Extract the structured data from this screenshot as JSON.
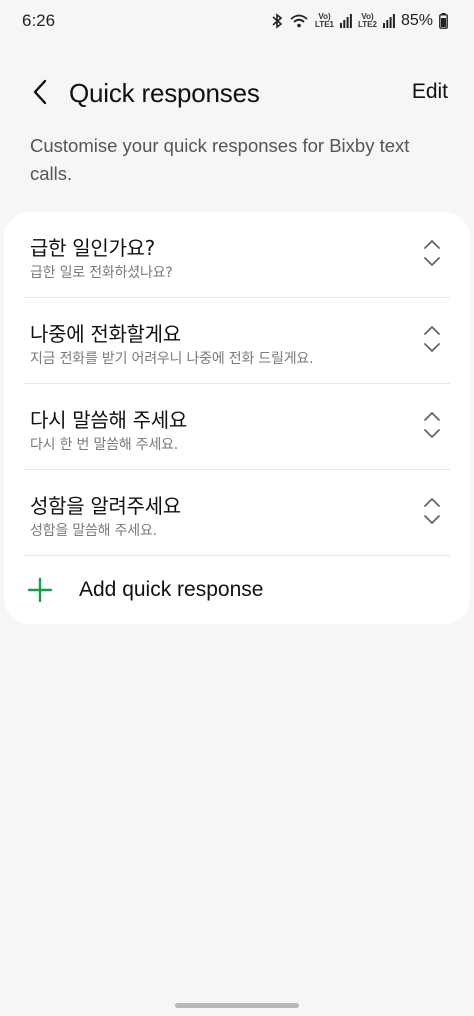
{
  "status_bar": {
    "time": "6:26",
    "battery": "85%",
    "sim1_label_top": "Vo)",
    "sim1_label_bottom": "LTE1",
    "sim2_label_top": "Vo)",
    "sim2_label_bottom": "LTE2",
    "icons": [
      "bluetooth-icon",
      "wifi-icon",
      "signal-icon",
      "battery-icon"
    ]
  },
  "header": {
    "title": "Quick responses",
    "edit_label": "Edit",
    "back_icon": "chevron-left-icon"
  },
  "description": "Customise your quick responses for Bixby text calls.",
  "responses": [
    {
      "title": "급한 일인가요?",
      "subtitle": "급한 일로 전화하셨나요?"
    },
    {
      "title": "나중에 전화할게요",
      "subtitle": "지금 전화를 받기 어려우니 나중에 전화 드릴게요."
    },
    {
      "title": "다시 말씀해 주세요",
      "subtitle": "다시 한 번 말씀해 주세요."
    },
    {
      "title": "성함을 알려주세요",
      "subtitle": "성함을 말씀해 주세요."
    }
  ],
  "add_response": {
    "label": "Add quick response",
    "icon": "plus-icon"
  },
  "colors": {
    "accent": "#1a9e4a",
    "background": "#f6f6f6",
    "card": "#ffffff"
  }
}
